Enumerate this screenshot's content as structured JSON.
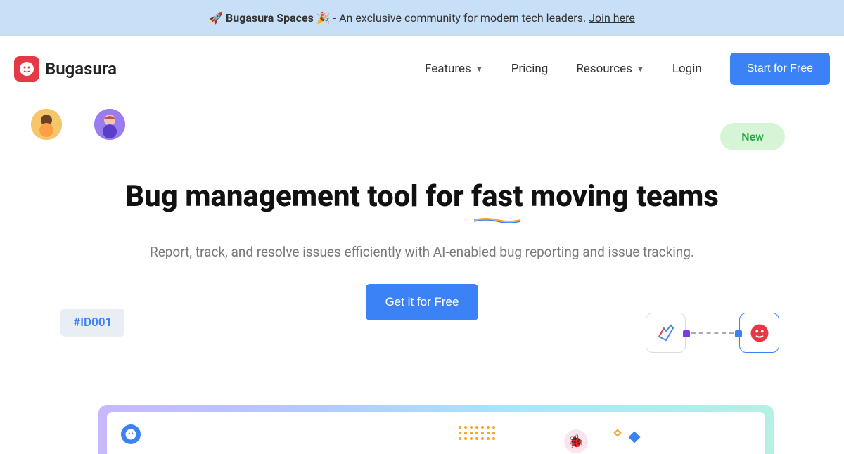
{
  "banner": {
    "rocket": "🚀",
    "strong": "Bugasura Spaces",
    "party": "🎉",
    "text": "- An exclusive community for modern tech leaders.",
    "link": "Join here"
  },
  "logo": {
    "text": "Bugasura"
  },
  "nav": {
    "features": "Features",
    "pricing": "Pricing",
    "resources": "Resources",
    "login": "Login",
    "start_free": "Start for Free"
  },
  "hero": {
    "new_pill": "New",
    "title": "Bug management tool for fast moving teams",
    "subtitle": "Report, track, and resolve issues efficiently with AI-enabled bug reporting and issue tracking.",
    "cta": "Get it for Free",
    "id_chip": "#ID001"
  }
}
